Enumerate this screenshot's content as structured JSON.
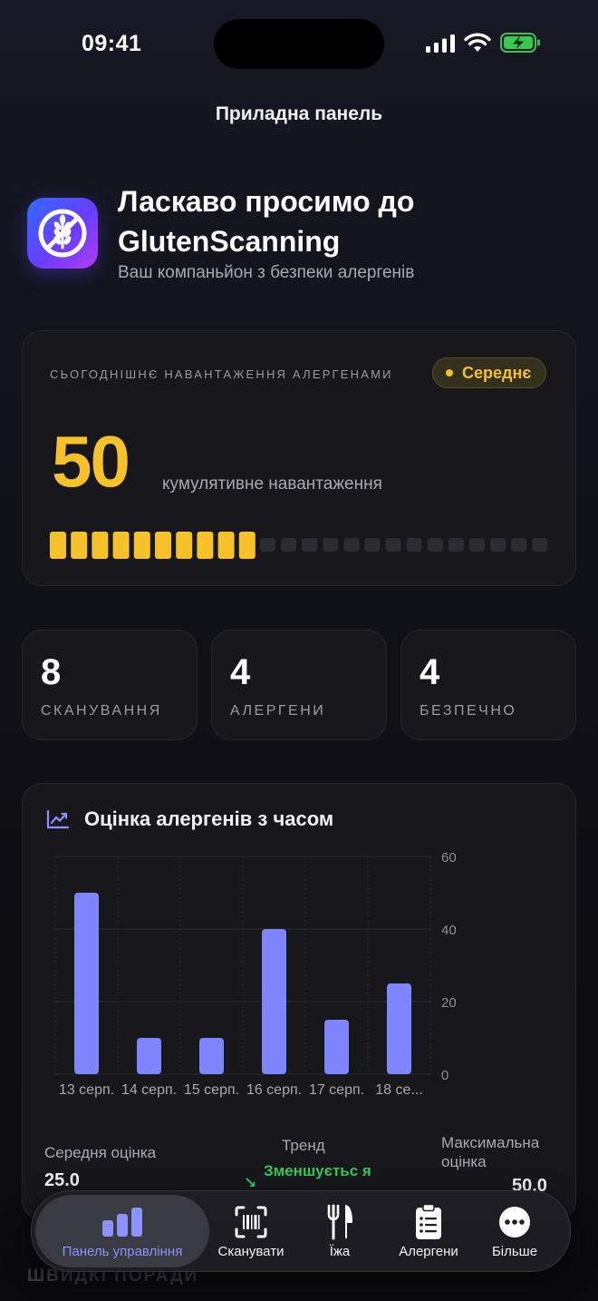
{
  "status_bar": {
    "time": "09:41"
  },
  "nav": {
    "title": "Приладна панель"
  },
  "welcome": {
    "title": "Ласкаво просимо до GlutenScanning",
    "subtitle": "Ваш компаньйон з безпеки алергенів",
    "app_icon": "no-wheat-icon"
  },
  "allergen_load": {
    "label": "СЬОГОДНІШНЄ НАВАНТАЖЕННЯ АЛЕРГЕНАМИ",
    "level": "Середнє",
    "value": "50",
    "caption": "кумулятивне навантаження",
    "segments_filled": 10,
    "segments_total": 24,
    "accent_color": "#f6c12b"
  },
  "stats": [
    {
      "value": "8",
      "label": "СКАНУВАННЯ"
    },
    {
      "value": "4",
      "label": "АЛЕРГЕНИ"
    },
    {
      "value": "4",
      "label": "БЕЗПЕЧНО"
    }
  ],
  "chart_section": {
    "title": "Оцінка алергенів з часом",
    "icon": "chart-line-icon",
    "summary": {
      "avg_label": "Середня оцінка",
      "avg_value": "25.0",
      "trend_label": "Тренд",
      "trend_value": "Зменшуєтьс я",
      "trend_color": "#34c759",
      "max_label": "Максимальна оцінка",
      "max_value": "50.0"
    }
  },
  "chart_data": {
    "type": "bar",
    "categories": [
      "13 серп.",
      "14 серп.",
      "15 серп.",
      "16 серп.",
      "17 серп.",
      "18 се..."
    ],
    "values": [
      50,
      10,
      10,
      40,
      15,
      25
    ],
    "ylim": [
      0,
      60
    ],
    "yticks": [
      "0",
      "20",
      "40",
      "60"
    ],
    "bar_color": "#7d86ff",
    "grid": true
  },
  "tips_peek": "ШВИДКІ ПОРАДИ",
  "tabbar": {
    "items": [
      {
        "label": "Панель управління",
        "icon": "bar-chart-icon",
        "active": true
      },
      {
        "label": "Сканувати",
        "icon": "barcode-scan-icon",
        "active": false
      },
      {
        "label": "Їжа",
        "icon": "fork-knife-icon",
        "active": false
      },
      {
        "label": "Алергени",
        "icon": "clipboard-list-icon",
        "active": false
      },
      {
        "label": "Більше",
        "icon": "more-dots-icon",
        "active": false
      }
    ],
    "active_color": "#8a93ff"
  }
}
